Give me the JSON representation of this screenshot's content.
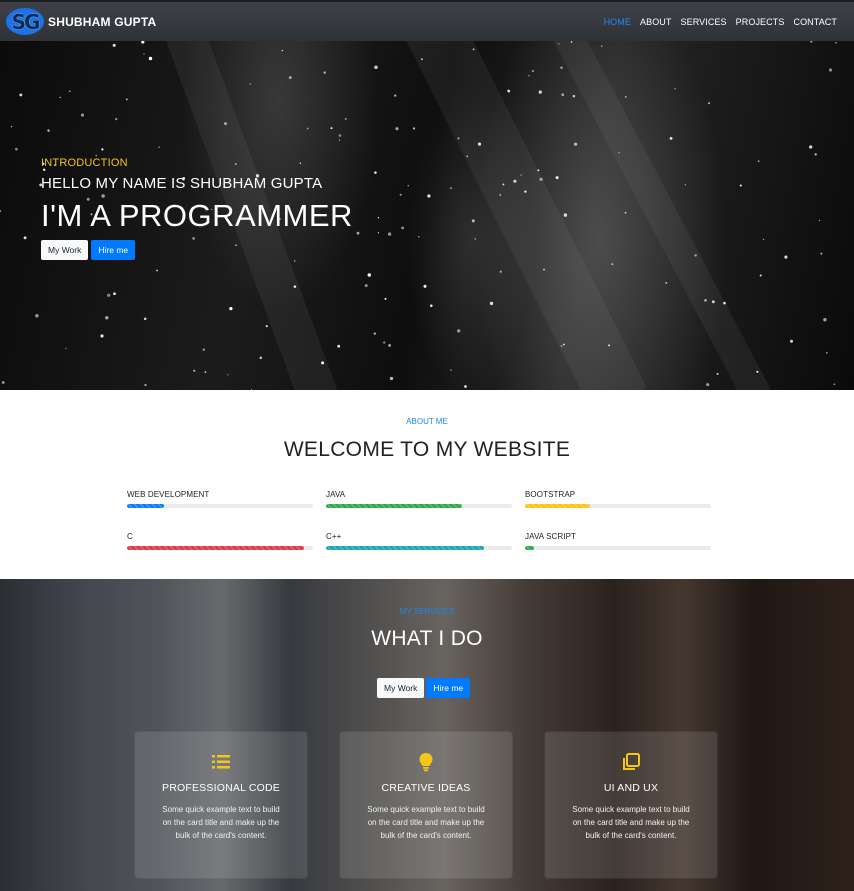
{
  "navbar": {
    "logo_text": "SG",
    "brand": "SHUBHAM GUPTA",
    "links": [
      "HOME",
      "ABOUT",
      "SERVICES",
      "PROJECTS",
      "CONTACT"
    ],
    "active_link": "HOME"
  },
  "hero": {
    "intro": "INTRODUCTION",
    "hello": "HELLO MY NAME IS SHUBHAM GUPTA",
    "title": "I'M A PROGRAMMER",
    "btn_work": "My Work",
    "btn_hire": "Hire me"
  },
  "about": {
    "label": "ABOUT ME",
    "title": "WELCOME TO MY WEBSITE",
    "skills": [
      {
        "label": "WEB DEVELOPMENT",
        "percent": 20,
        "color": "#007bff"
      },
      {
        "label": "JAVA",
        "percent": 73,
        "color": "#28a745"
      },
      {
        "label": "BOOTSTRAP",
        "percent": 35,
        "color": "#ffc107"
      },
      {
        "label": "C",
        "percent": 95,
        "color": "#dc3545"
      },
      {
        "label": "C++",
        "percent": 85,
        "color": "#17a2b8"
      },
      {
        "label": "JAVA SCRIPT",
        "percent": 5,
        "color": "#28a745"
      }
    ]
  },
  "services": {
    "label": "MY SERVICES",
    "title": "WHAT I DO",
    "btn_work": "My Work",
    "btn_hire": "Hire me",
    "cards": [
      {
        "icon": "list-icon",
        "title": "PROFESSIONAL CODE",
        "text": "Some quick example text to build on the card title and make up the bulk of the card's content."
      },
      {
        "icon": "lightbulb-icon",
        "title": "CREATIVE IDEAS",
        "text": "Some quick example text to build on the card title and make up the bulk of the card's content."
      },
      {
        "icon": "clone-icon",
        "title": "UI AND UX",
        "text": "Some quick example text to build on the card title and make up the bulk of the card's content."
      }
    ]
  },
  "colors": {
    "accent": "#007bff",
    "highlight": "#f5c518",
    "navbar": "#343a40"
  }
}
